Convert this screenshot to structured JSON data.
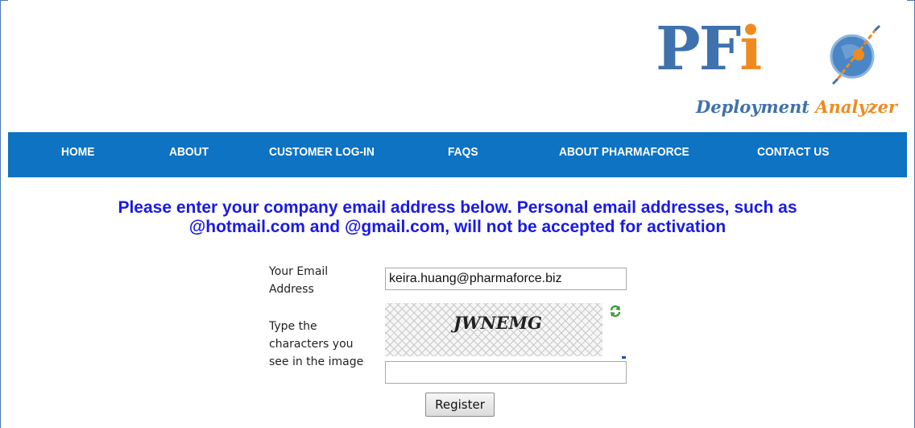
{
  "logo": {
    "main_pf": "PF",
    "main_i": "i",
    "sub_deployment": "Deployment",
    "sub_analyzer": "Analyzer",
    "brand_blue": "#3f72ad",
    "brand_orange": "#ef8a1f"
  },
  "nav": {
    "bg_color": "#0d73c2",
    "items": [
      {
        "label": "HOME"
      },
      {
        "label": "ABOUT"
      },
      {
        "label": "CUSTOMER LOG-IN"
      },
      {
        "label": "FAQS"
      },
      {
        "label": "ABOUT PHARMAFORCE"
      },
      {
        "label": "CONTACT US"
      }
    ]
  },
  "notice": {
    "line1": "Please enter your company email address below. Personal email addresses, such as",
    "line2": "@hotmail.com and @gmail.com, will not be accepted for activation",
    "color": "#1a1ae6"
  },
  "form": {
    "email_label_1": "Your Email",
    "email_label_2": "Address",
    "email_value": "keira.huang@pharmaforce.biz",
    "captcha_label_1": "Type the",
    "captcha_label_2": "characters you",
    "captcha_label_3": "see in the image",
    "captcha_text": "JWNEMG",
    "captcha_value": "",
    "refresh_icon": "refresh-icon",
    "register_label": "Register"
  }
}
